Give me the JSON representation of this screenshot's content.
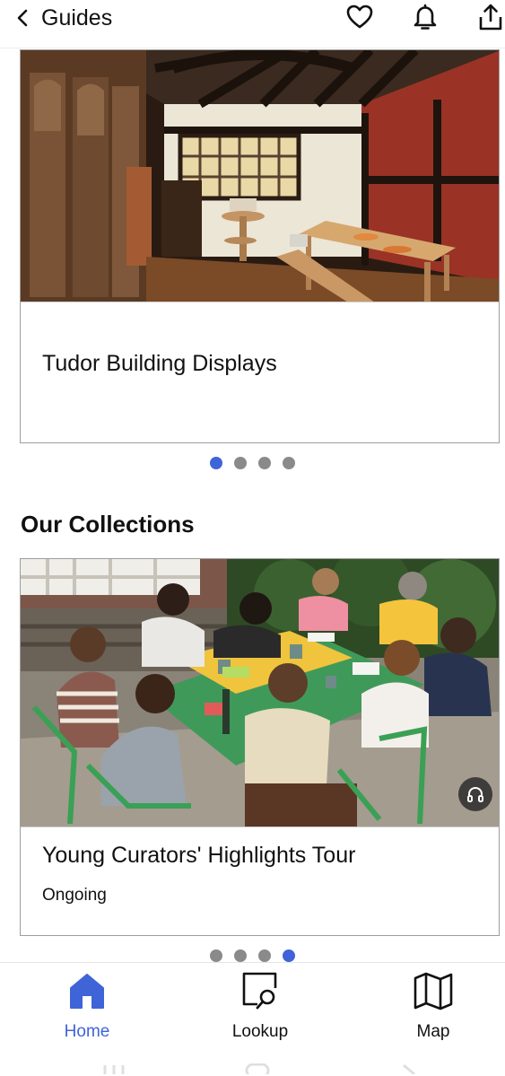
{
  "header": {
    "title": "Guides",
    "icons": [
      "back-chevron-icon",
      "heart-icon",
      "bell-icon",
      "share-icon"
    ]
  },
  "carousel_top": {
    "card": {
      "title": "Tudor Building Displays",
      "image": "tudor-interior-photo"
    },
    "dots": 4,
    "active_dot": 1
  },
  "collections": {
    "heading": "Our Collections",
    "card": {
      "title": "Young Curators' Highlights Tour",
      "subtitle": "Ongoing",
      "image": "young-curators-workshop-photo",
      "badge_icon": "headphones-icon"
    },
    "dots": 4,
    "active_dot": 4
  },
  "bottom_nav": {
    "items": [
      {
        "label": "Home",
        "icon": "home-icon",
        "active": true
      },
      {
        "label": "Lookup",
        "icon": "lookup-icon",
        "active": false
      },
      {
        "label": "Map",
        "icon": "map-icon",
        "active": false
      }
    ]
  },
  "colors": {
    "accent": "#3f64d8",
    "dot_inactive": "#8a8a8a",
    "card_border": "#9e9e9e"
  }
}
